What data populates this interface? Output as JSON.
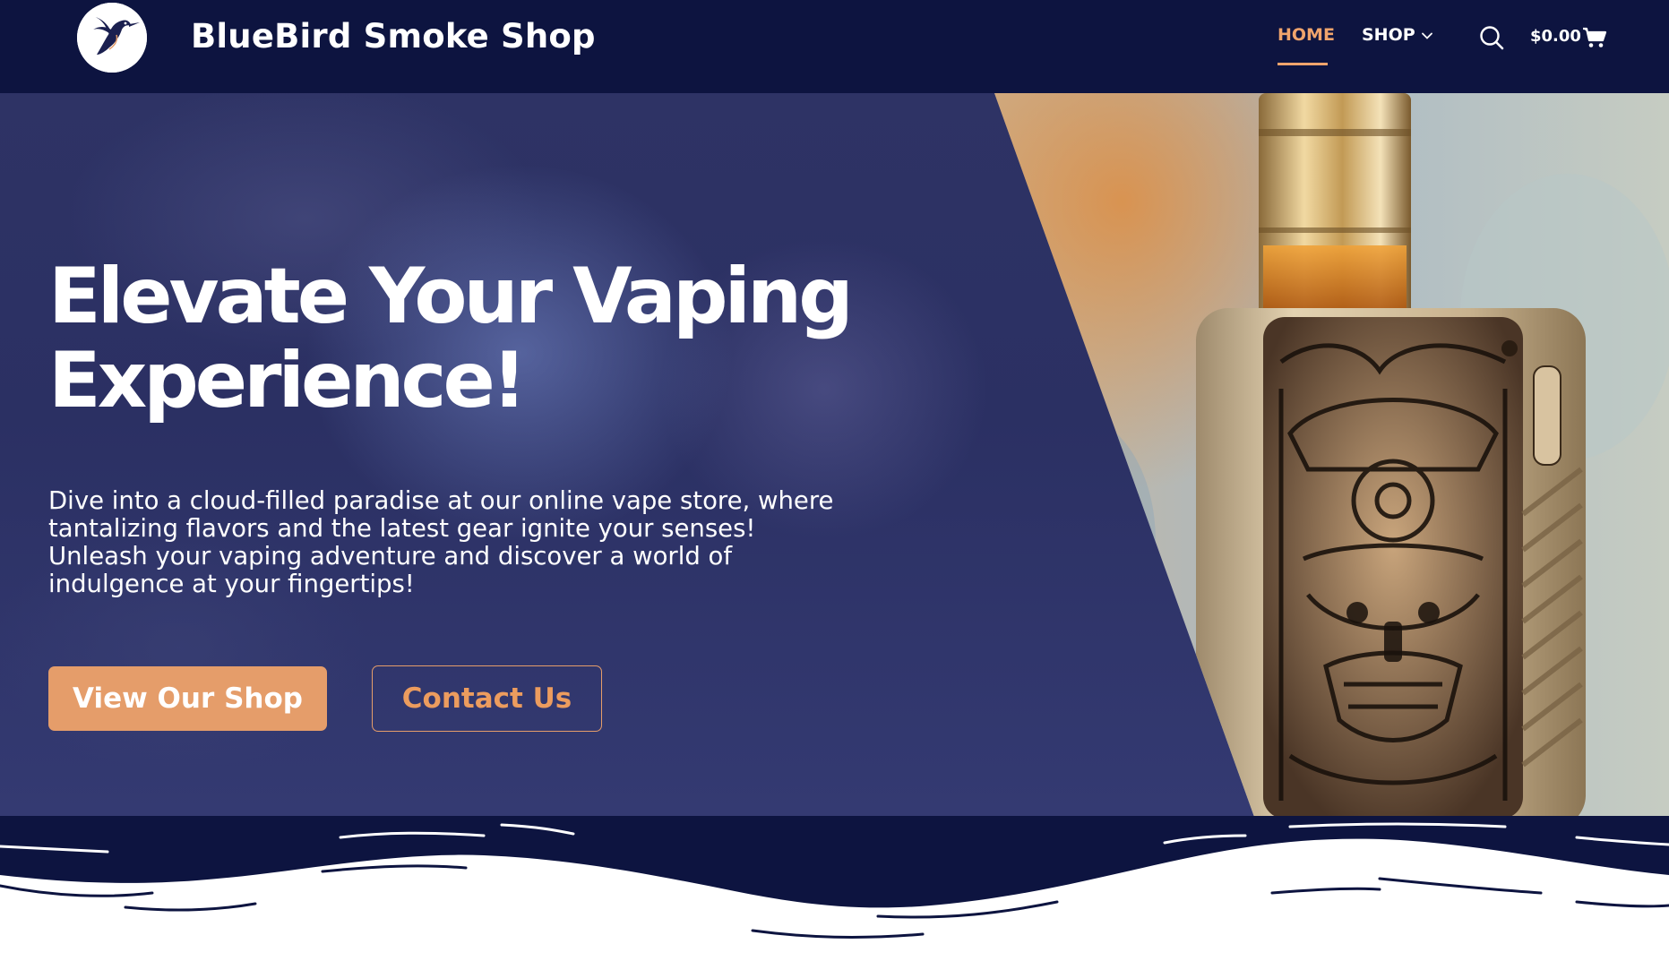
{
  "header": {
    "brand": "BlueBird Smoke Shop",
    "logo_icon": "hummingbird-icon",
    "nav": {
      "home": "HOME",
      "shop": "SHOP"
    },
    "cart_total": "$0.00",
    "icons": [
      "hummingbird-icon",
      "chevron-down-icon",
      "search-icon",
      "cart-icon"
    ]
  },
  "hero": {
    "title_line1": "Elevate Your Vaping",
    "title_line2": "Experience!",
    "subtitle_line1": "Dive into a cloud-filled paradise at our online vape store, where",
    "subtitle_line2": "tantalizing flavors and the latest gear ignite your senses!",
    "subtitle_line3": "Unleash your vaping adventure and discover a world of",
    "subtitle_line4": "indulgence at your fingertips!",
    "primary_button": "View Our Shop",
    "secondary_button": "Contact Us"
  },
  "colors": {
    "navy": "#0d1440",
    "accent": "#e59d6a",
    "active_nav": "#f0a46c",
    "white": "#ffffff"
  }
}
